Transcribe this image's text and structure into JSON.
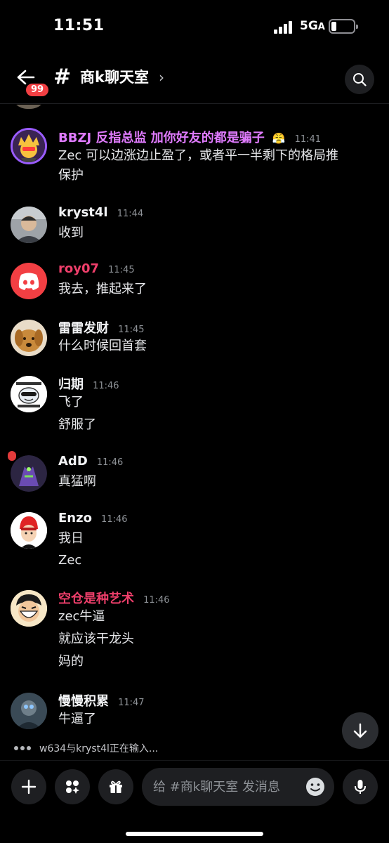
{
  "status_bar": {
    "time": "11:51",
    "network": "5G",
    "network_suffix": "A"
  },
  "header": {
    "back_badge": "99",
    "hash": "#",
    "title": "商k聊天室",
    "chevron": "›"
  },
  "messages": [
    {
      "user": "BBZJ 反指总监 加你好友的都是骗子",
      "time": "11:41",
      "user_color": "#e07bff",
      "status_emoji": "😤",
      "lines": [
        "Zec 可以边涨边止盈了，或者平一半剩下的格局推",
        "保护"
      ]
    },
    {
      "user": "kryst4l",
      "time": "11:44",
      "user_color": "#f2f3f5",
      "lines": [
        "收到"
      ]
    },
    {
      "user": "roy07",
      "time": "11:45",
      "user_color": "#ef3f6b",
      "lines": [
        "我去，推起来了"
      ]
    },
    {
      "user": "雷雷发财",
      "time": "11:45",
      "user_color": "#f2f3f5",
      "lines": [
        "什么时候回首套"
      ]
    },
    {
      "user": "归期",
      "time": "11:46",
      "user_color": "#f2f3f5",
      "lines": [
        "飞了",
        "舒服了"
      ]
    },
    {
      "user": "AdD",
      "time": "11:46",
      "user_color": "#f2f3f5",
      "lines": [
        "真猛啊"
      ]
    },
    {
      "user": "Enzo",
      "time": "11:46",
      "user_color": "#f2f3f5",
      "lines": [
        "我日",
        "Zec"
      ]
    },
    {
      "user": "空仓是种艺术",
      "time": "11:46",
      "user_color": "#ef3f6b",
      "lines": [
        "zec牛逼",
        "就应该干龙头",
        "妈的"
      ]
    },
    {
      "user": "慢慢积累",
      "time": "11:47",
      "user_color": "#f2f3f5",
      "lines": [
        "牛逼了"
      ]
    }
  ],
  "typing": {
    "text": "w634与kryst4l正在输入..."
  },
  "composer": {
    "placeholder": "给 #商k聊天室 发消息"
  },
  "colors": {
    "background": "#000000",
    "badge": "#f23f43",
    "discord_blurple": "#5865f2",
    "button_bg": "#1e1f22"
  }
}
